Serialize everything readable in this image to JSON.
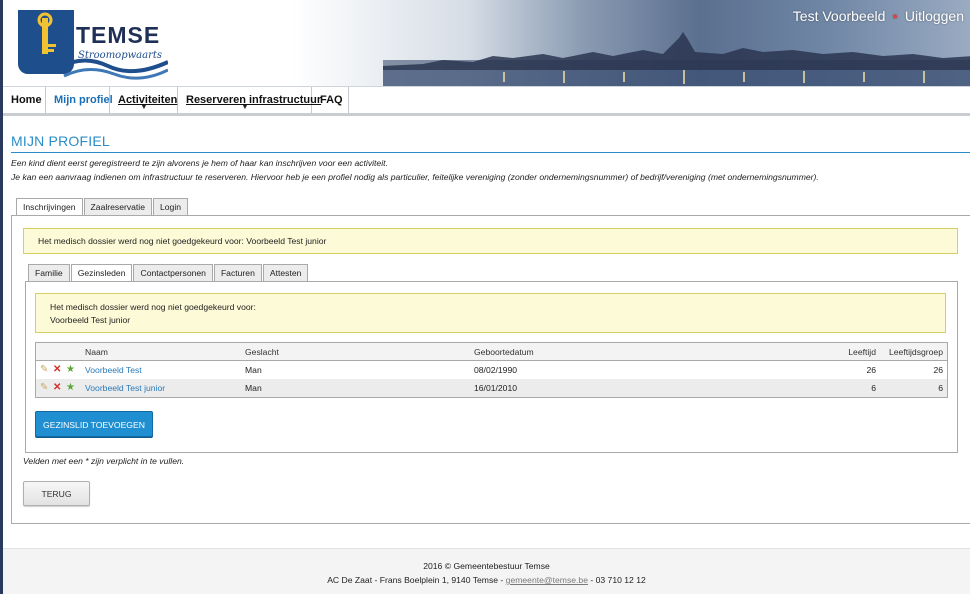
{
  "header": {
    "logo_title": "TEMSE",
    "logo_subtitle": "Stroomopwaarts",
    "user_name": "Test Voorbeeld",
    "logout_label": "Uitloggen"
  },
  "nav": {
    "items": [
      {
        "label": "Home"
      },
      {
        "label": "Mijn profiel"
      },
      {
        "label": "Activiteiten"
      },
      {
        "label": "Reserveren infrastructuur"
      },
      {
        "label": "FAQ"
      }
    ]
  },
  "page": {
    "title": "MIJN PROFIEL",
    "intro_line1": "Een kind dient eerst geregistreerd te zijn alvorens je hem of haar kan inschrijven voor een activiteit.",
    "intro_line2": "Je kan een aanvraag indienen om infrastructuur te reserveren. Hiervoor heb je een profiel nodig als particulier, feitelijke vereniging (zonder ondernemingsnummer) of bedrijf/vereniging (met ondernemingsnummer)."
  },
  "main_tabs": [
    {
      "label": "Inschrijvingen"
    },
    {
      "label": "Zaalreservatie"
    },
    {
      "label": "Login"
    }
  ],
  "alert_outer": "Het medisch dossier werd nog niet goedgekeurd voor: Voorbeeld Test junior",
  "sub_tabs": [
    {
      "label": "Familie"
    },
    {
      "label": "Gezinsleden"
    },
    {
      "label": "Contactpersonen"
    },
    {
      "label": "Facturen"
    },
    {
      "label": "Attesten"
    }
  ],
  "alert_inner": {
    "line1": "Het medisch dossier werd nog niet goedgekeurd voor:",
    "line2": "Voorbeeld Test junior"
  },
  "table": {
    "headers": {
      "name": "Naam",
      "gender": "Geslacht",
      "birthdate": "Geboortedatum",
      "age": "Leeftijd",
      "age_group": "Leeftijdsgroep"
    },
    "rows": [
      {
        "name": "Voorbeeld Test",
        "gender": "Man",
        "birthdate": "08/02/1990",
        "age": "26",
        "age_group": "26"
      },
      {
        "name": "Voorbeeld Test junior",
        "gender": "Man",
        "birthdate": "16/01/2010",
        "age": "6",
        "age_group": "6"
      }
    ]
  },
  "buttons": {
    "add_member": "GEZINSLID TOEVOEGEN",
    "back": "TERUG"
  },
  "required_note": "Velden met een * zijn verplicht in te vullen.",
  "footer": {
    "line1": "2016 © Gemeentebestuur Temse",
    "address": "AC De Zaat - Frans Boelplein 1, 9140 Temse - ",
    "email": "gemeente@temse.be",
    "phone": " - 03 710 12 12"
  },
  "colors": {
    "accent": "#2a8cc9",
    "primary_button": "#1f8fd2",
    "alert_bg": "#fdfbd7",
    "nav_active": "#1a6fb5"
  }
}
